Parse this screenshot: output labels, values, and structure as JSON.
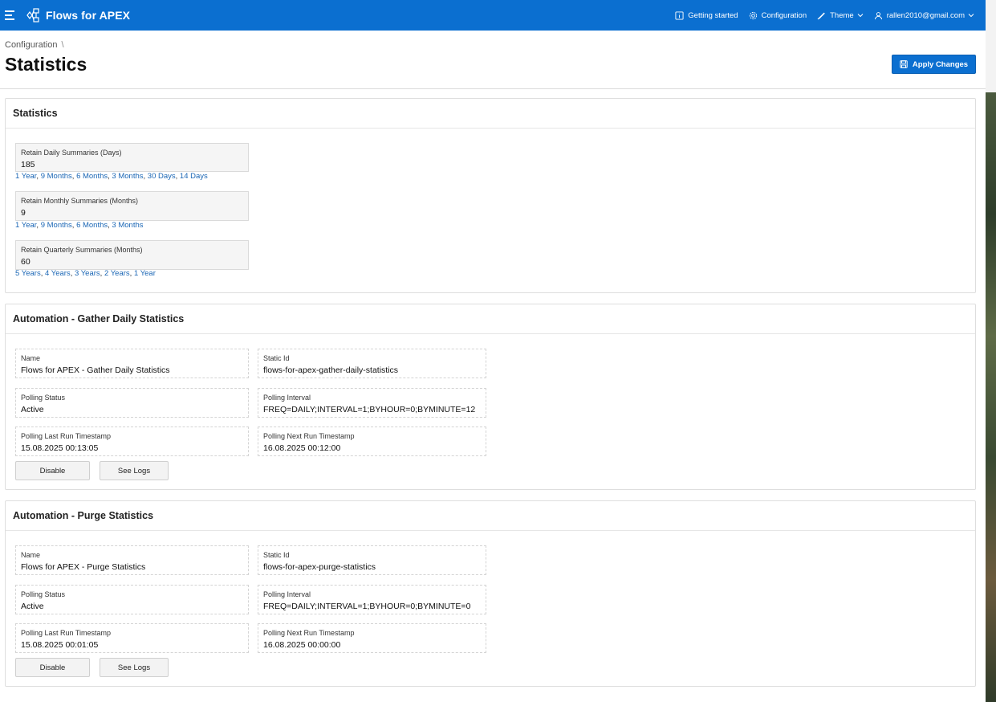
{
  "header": {
    "app_title": "Flows for APEX",
    "nav": {
      "getting_started": "Getting started",
      "configuration": "Configuration",
      "theme": "Theme",
      "user": "rallen2010@gmail.com"
    },
    "accent_color": "#0b6fd0"
  },
  "breadcrumb": {
    "parent": "Configuration",
    "separator": "\\"
  },
  "page_title": "Statistics",
  "apply_button": "Apply Changes",
  "statistics": {
    "title": "Statistics",
    "fields": [
      {
        "label": "Retain Daily Summaries (Days)",
        "value": "185",
        "shortcuts": [
          "1 Year",
          "9 Months",
          "6 Months",
          "3 Months",
          "30 Days",
          "14 Days"
        ]
      },
      {
        "label": "Retain Monthly Summaries (Months)",
        "value": "9",
        "shortcuts": [
          "1 Year",
          "9 Months",
          "6 Months",
          "3 Months"
        ]
      },
      {
        "label": "Retain Quarterly Summaries (Months)",
        "value": "60",
        "shortcuts": [
          "5 Years",
          "4 Years",
          "3 Years",
          "2 Years",
          "1 Year"
        ]
      }
    ]
  },
  "automation_daily": {
    "title": "Automation - Gather Daily Statistics",
    "name_label": "Name",
    "name": "Flows for APEX - Gather Daily Statistics",
    "static_id_label": "Static Id",
    "static_id": "flows-for-apex-gather-daily-statistics",
    "polling_status_label": "Polling Status",
    "polling_status": "Active",
    "polling_interval_label": "Polling Interval",
    "polling_interval": "FREQ=DAILY;INTERVAL=1;BYHOUR=0;BYMINUTE=12",
    "last_run_label": "Polling Last Run Timestamp",
    "last_run": "15.08.2025 00:13:05",
    "next_run_label": "Polling Next Run Timestamp",
    "next_run": "16.08.2025 00:12:00",
    "disable_button": "Disable",
    "logs_button": "See Logs"
  },
  "automation_purge": {
    "title": "Automation - Purge Statistics",
    "name_label": "Name",
    "name": "Flows for APEX - Purge Statistics",
    "static_id_label": "Static Id",
    "static_id": "flows-for-apex-purge-statistics",
    "polling_status_label": "Polling Status",
    "polling_status": "Active",
    "polling_interval_label": "Polling Interval",
    "polling_interval": "FREQ=DAILY;INTERVAL=1;BYHOUR=0;BYMINUTE=0",
    "last_run_label": "Polling Last Run Timestamp",
    "last_run": "15.08.2025 00:01:05",
    "next_run_label": "Polling Next Run Timestamp",
    "next_run": "16.08.2025 00:00:00",
    "disable_button": "Disable",
    "logs_button": "See Logs"
  }
}
